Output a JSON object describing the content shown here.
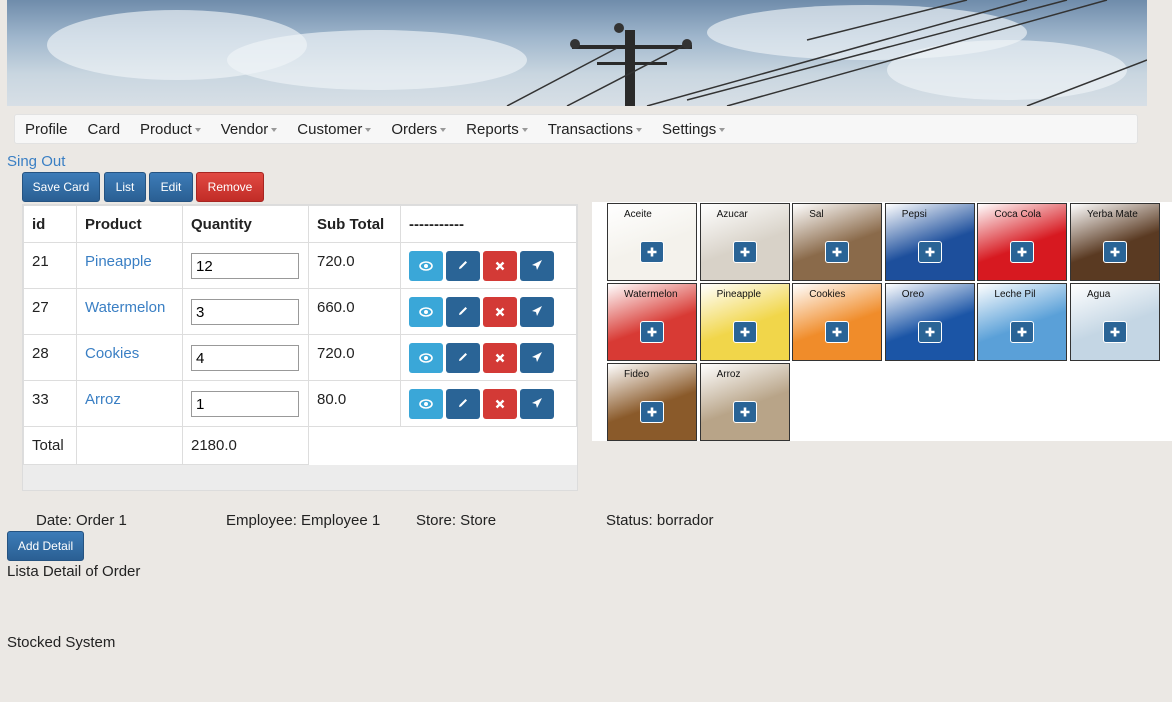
{
  "nav": {
    "items": [
      {
        "label": "Profile",
        "caret": false
      },
      {
        "label": "Card",
        "caret": false
      },
      {
        "label": "Product",
        "caret": true
      },
      {
        "label": "Vendor",
        "caret": true
      },
      {
        "label": "Customer",
        "caret": true
      },
      {
        "label": "Orders",
        "caret": true
      },
      {
        "label": "Reports",
        "caret": true
      },
      {
        "label": "Transactions",
        "caret": true
      },
      {
        "label": "Settings",
        "caret": true
      }
    ]
  },
  "signout_label": "Sing Out",
  "toolbar": {
    "save": "Save Card",
    "list": "List",
    "edit": "Edit",
    "remove": "Remove"
  },
  "table": {
    "headers": [
      "id",
      "Product",
      "Quantity",
      "Sub Total",
      "-----------"
    ],
    "rows": [
      {
        "id": "21",
        "product": "Pineapple",
        "quantity": "12",
        "subtotal": "720.0"
      },
      {
        "id": "27",
        "product": "Watermelon",
        "quantity": "3",
        "subtotal": "660.0"
      },
      {
        "id": "28",
        "product": "Cookies",
        "quantity": "4",
        "subtotal": "720.0"
      },
      {
        "id": "33",
        "product": "Arroz",
        "quantity": "1",
        "subtotal": "80.0"
      }
    ],
    "total_label": "Total",
    "total_value": "2180.0"
  },
  "products": [
    {
      "name": "Aceite",
      "bg": "#f4f2ec"
    },
    {
      "name": "Azucar",
      "bg": "#d8d2c8"
    },
    {
      "name": "Sal",
      "bg": "#8a6a4a"
    },
    {
      "name": "Pepsi",
      "bg": "#1d4f9c"
    },
    {
      "name": "Coca Cola",
      "bg": "#d71920"
    },
    {
      "name": "Yerba Mate",
      "bg": "#5a3a22"
    },
    {
      "name": "Watermelon",
      "bg": "#d83a34"
    },
    {
      "name": "Pineapple",
      "bg": "#f1d64a"
    },
    {
      "name": "Cookies",
      "bg": "#f08c2a"
    },
    {
      "name": "Oreo",
      "bg": "#1b55a6"
    },
    {
      "name": "Leche Pil",
      "bg": "#5aa0d8"
    },
    {
      "name": "Agua",
      "bg": "#c4d6e4"
    },
    {
      "name": "Fideo",
      "bg": "#8a5a2a"
    },
    {
      "name": "Arroz",
      "bg": "#b8a488"
    }
  ],
  "info": {
    "date": "Date: Order 1",
    "employee": "Employee: Employee 1",
    "store": "Store: Store",
    "status": "Status: borrador"
  },
  "add_detail": "Add Detail",
  "list_title": "Lista Detail of Order",
  "footer": "Stocked System"
}
